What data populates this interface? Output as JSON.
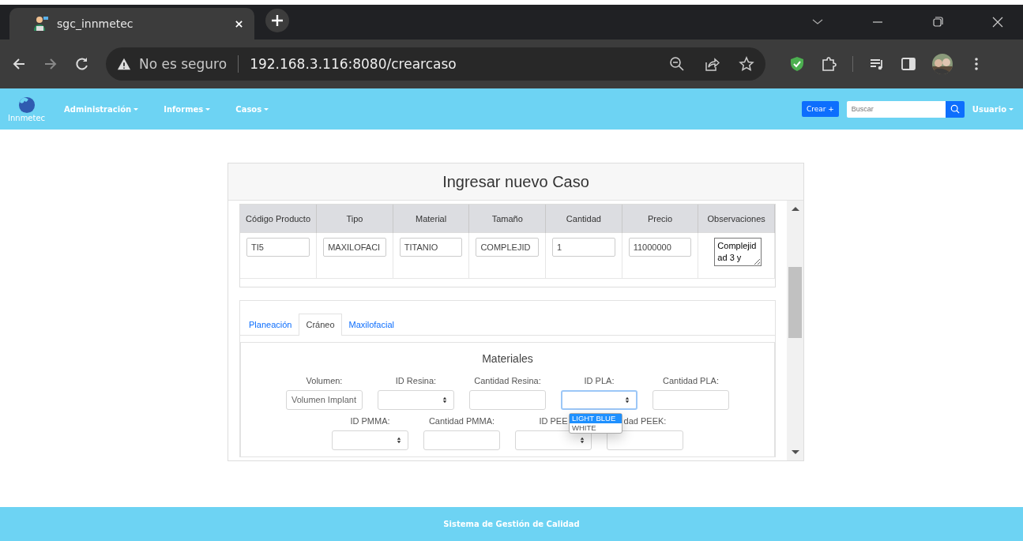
{
  "browser": {
    "tab": {
      "title": "sgc_innmetec"
    },
    "security": "No es seguro",
    "url": "192.168.3.116:8080/crearcaso"
  },
  "navbar": {
    "brand": "Innmetec",
    "menu": [
      "Administración",
      "Informes",
      "Casos"
    ],
    "create_button": "Crear +",
    "search": {
      "placeholder": "Buscar"
    },
    "user_menu": "Usuario"
  },
  "card": {
    "title": "Ingresar nuevo Caso",
    "table": {
      "columns": [
        "Código Producto",
        "Tipo",
        "Material",
        "Tamaño",
        "Cantidad",
        "Precio",
        "Observaciones"
      ],
      "rows": [
        {
          "cells": [
            "TI5",
            "MAXILOFACI",
            "TITANIO",
            "COMPLEJID",
            "1",
            "11000000"
          ],
          "observations": "Complejidad 3 y"
        }
      ]
    },
    "tabs": [
      {
        "label": "Planeación",
        "selected": false
      },
      {
        "label": "Cráneo",
        "selected": true
      },
      {
        "label": "Maxilofacial",
        "selected": false
      }
    ],
    "section_title": "Materiales",
    "field_rows": [
      [
        {
          "label": "Volumen:",
          "kind": "input",
          "placeholder": "Volumen Implant"
        },
        {
          "label": "ID Resina:",
          "kind": "select",
          "open": false
        },
        {
          "label": "Cantidad Resina:",
          "kind": "input"
        },
        {
          "label": "ID PLA:",
          "kind": "select",
          "open": true,
          "options": [
            {
              "label": "LIGHT BLUE",
              "selected": true
            },
            {
              "label": "WHITE",
              "selected": false
            }
          ]
        },
        {
          "label": "Cantidad PLA:",
          "kind": "input"
        }
      ],
      [
        {
          "label": "ID PMMA:",
          "kind": "select",
          "open": false
        },
        {
          "label": "Cantidad PMMA:",
          "kind": "input"
        },
        {
          "label": "ID PEE",
          "kind": "select",
          "open": false
        },
        {
          "label": "dad PEEK:",
          "kind": "input"
        }
      ]
    ]
  },
  "footer": "Sistema de Gestión de Calidad"
}
